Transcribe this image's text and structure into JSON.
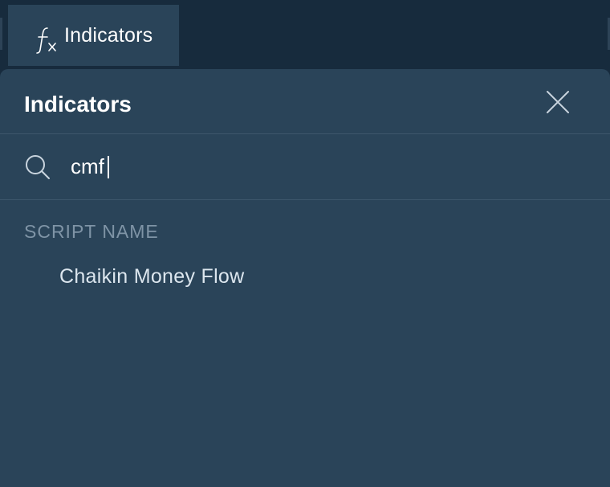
{
  "toolbar": {
    "button_label": "Indicators",
    "button_icon": "function-fx-icon"
  },
  "dialog": {
    "title": "Indicators",
    "close_icon": "close-icon",
    "search": {
      "icon": "search-icon",
      "value": "cmf"
    },
    "section_label": "SCRIPT NAME",
    "results": [
      {
        "label": "Chaikin Money Flow"
      }
    ]
  },
  "colors": {
    "toolbar_bg": "#172b3d",
    "panel_bg": "#2a4459",
    "divider": "#3d566b",
    "muted_text": "#7f94a6",
    "text": "#ffffff"
  }
}
